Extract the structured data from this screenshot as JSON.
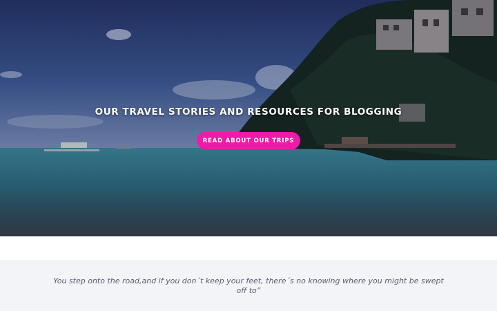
{
  "hero": {
    "title": "Our travel stories and resources for blogging",
    "cta_label": "Read about our trips",
    "colors": {
      "cta_background": "#f01aa8",
      "title_text": "#ffffff"
    },
    "image": "tropical-beach-cliff-resort-photo"
  },
  "quote": {
    "text": "You step onto the road,and if you don´t keep your feet, there´s no knowing where you might be swept off to”"
  }
}
